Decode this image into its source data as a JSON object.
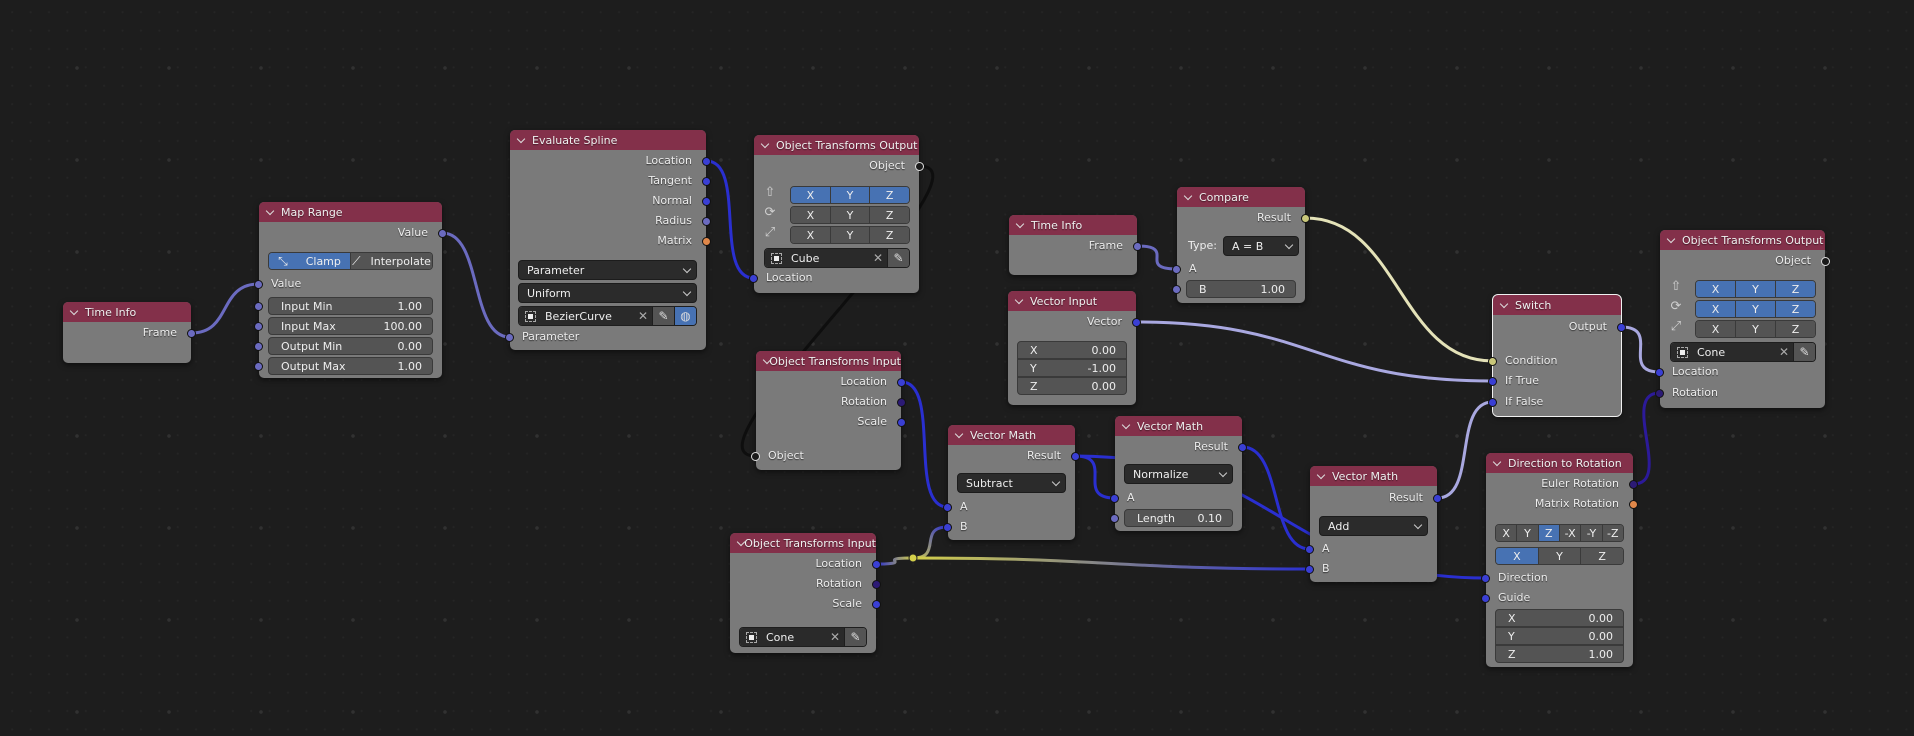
{
  "editor": "Geometry Node Editor",
  "colors": {
    "header": "#83304a",
    "node_body": "#7a7a7a",
    "background": "#1d1d1d",
    "vector_socket": "#3a3fd4",
    "float_socket": "#6b6bc0",
    "boolean_socket": "#c9c77a",
    "object_socket": "#1a1a1a",
    "matrix_socket": "#e0884a",
    "rotation_socket": "#2c1a75",
    "geometry_socket": "#d45ed4",
    "selected_toggle": "#4772b3"
  },
  "nodes": {
    "time_info_1": {
      "title": "Time Info",
      "outputs": [
        "Frame"
      ]
    },
    "map_range": {
      "title": "Map Range",
      "outputs": [
        "Value"
      ],
      "modes": [
        "Clamp",
        "Interpolate"
      ],
      "active_mode": "Clamp",
      "input_value_label": "Value",
      "fields": [
        {
          "label": "Input Min",
          "value": "1.00"
        },
        {
          "label": "Input Max",
          "value": "100.00"
        },
        {
          "label": "Output Min",
          "value": "0.00"
        },
        {
          "label": "Output Max",
          "value": "1.00"
        }
      ]
    },
    "evaluate_spline": {
      "title": "Evaluate Spline",
      "outputs": [
        "Location",
        "Tangent",
        "Normal",
        "Radius",
        "Matrix"
      ],
      "mode_dropdown": "Parameter",
      "sampling_dropdown": "Uniform",
      "object": "BezierCurve",
      "inputs": [
        "Parameter"
      ]
    },
    "object_transforms_output_1": {
      "title": "Object Transforms Output",
      "outputs": [
        "Object"
      ],
      "axis_rows": [
        {
          "icon": "location-arrow-icon",
          "axes": [
            "X",
            "Y",
            "Z"
          ],
          "enabled": [
            true,
            true,
            true
          ]
        },
        {
          "icon": "rotation-icon",
          "axes": [
            "X",
            "Y",
            "Z"
          ],
          "enabled": [
            false,
            false,
            false
          ]
        },
        {
          "icon": "scale-icon",
          "axes": [
            "X",
            "Y",
            "Z"
          ],
          "enabled": [
            false,
            false,
            false
          ]
        }
      ],
      "object": "Cube",
      "inputs": [
        "Location"
      ]
    },
    "object_transforms_input_1": {
      "title": "Object Transforms Input",
      "outputs": [
        "Location",
        "Rotation",
        "Scale"
      ],
      "inputs": [
        "Object"
      ]
    },
    "object_transforms_input_2": {
      "title": "Object Transforms Input",
      "outputs": [
        "Location",
        "Rotation",
        "Scale"
      ],
      "object": "Cone"
    },
    "vector_math_subtract": {
      "title": "Vector Math",
      "outputs": [
        "Result"
      ],
      "operation": "Subtract",
      "inputs": [
        "A",
        "B"
      ]
    },
    "vector_math_normalize": {
      "title": "Vector Math",
      "outputs": [
        "Result"
      ],
      "operation": "Normalize",
      "inputs": [
        "A"
      ],
      "length": {
        "label": "Length",
        "value": "0.10"
      }
    },
    "time_info_2": {
      "title": "Time Info",
      "outputs": [
        "Frame"
      ]
    },
    "vector_input": {
      "title": "Vector Input",
      "outputs": [
        "Vector"
      ],
      "values": [
        {
          "label": "X",
          "value": "0.00"
        },
        {
          "label": "Y",
          "value": "-1.00"
        },
        {
          "label": "Z",
          "value": "0.00"
        }
      ]
    },
    "compare": {
      "title": "Compare",
      "outputs": [
        "Result"
      ],
      "type_label": "Type:",
      "type_value": "A = B",
      "inputs": [
        "A"
      ],
      "b_field": {
        "label": "B",
        "value": "1.00"
      }
    },
    "switch": {
      "title": "Switch",
      "outputs": [
        "Output"
      ],
      "inputs": [
        "Condition",
        "If True",
        "If False"
      ]
    },
    "vector_math_add": {
      "title": "Vector Math",
      "outputs": [
        "Result"
      ],
      "operation": "Add",
      "inputs": [
        "A",
        "B"
      ]
    },
    "direction_to_rotation": {
      "title": "Direction to Rotation",
      "outputs": [
        "Euler Rotation",
        "Matrix Rotation"
      ],
      "track_axes": [
        "X",
        "Y",
        "Z",
        "-X",
        "-Y",
        "-Z"
      ],
      "track_axis_active": "Z",
      "up_axes": [
        "X",
        "Y",
        "Z"
      ],
      "up_axis_active": "X",
      "inputs": [
        "Direction",
        "Guide"
      ],
      "guide_values": [
        {
          "label": "X",
          "value": "0.00"
        },
        {
          "label": "Y",
          "value": "0.00"
        },
        {
          "label": "Z",
          "value": "1.00"
        }
      ]
    },
    "object_transforms_output_2": {
      "title": "Object Transforms Output",
      "outputs": [
        "Object"
      ],
      "axis_rows": [
        {
          "icon": "location-arrow-icon",
          "axes": [
            "X",
            "Y",
            "Z"
          ],
          "enabled": [
            true,
            true,
            true
          ]
        },
        {
          "icon": "rotation-icon",
          "axes": [
            "X",
            "Y",
            "Z"
          ],
          "enabled": [
            true,
            true,
            true
          ]
        },
        {
          "icon": "scale-icon",
          "axes": [
            "X",
            "Y",
            "Z"
          ],
          "enabled": [
            false,
            false,
            false
          ]
        }
      ],
      "object": "Cone",
      "inputs": [
        "Location",
        "Rotation"
      ]
    }
  }
}
